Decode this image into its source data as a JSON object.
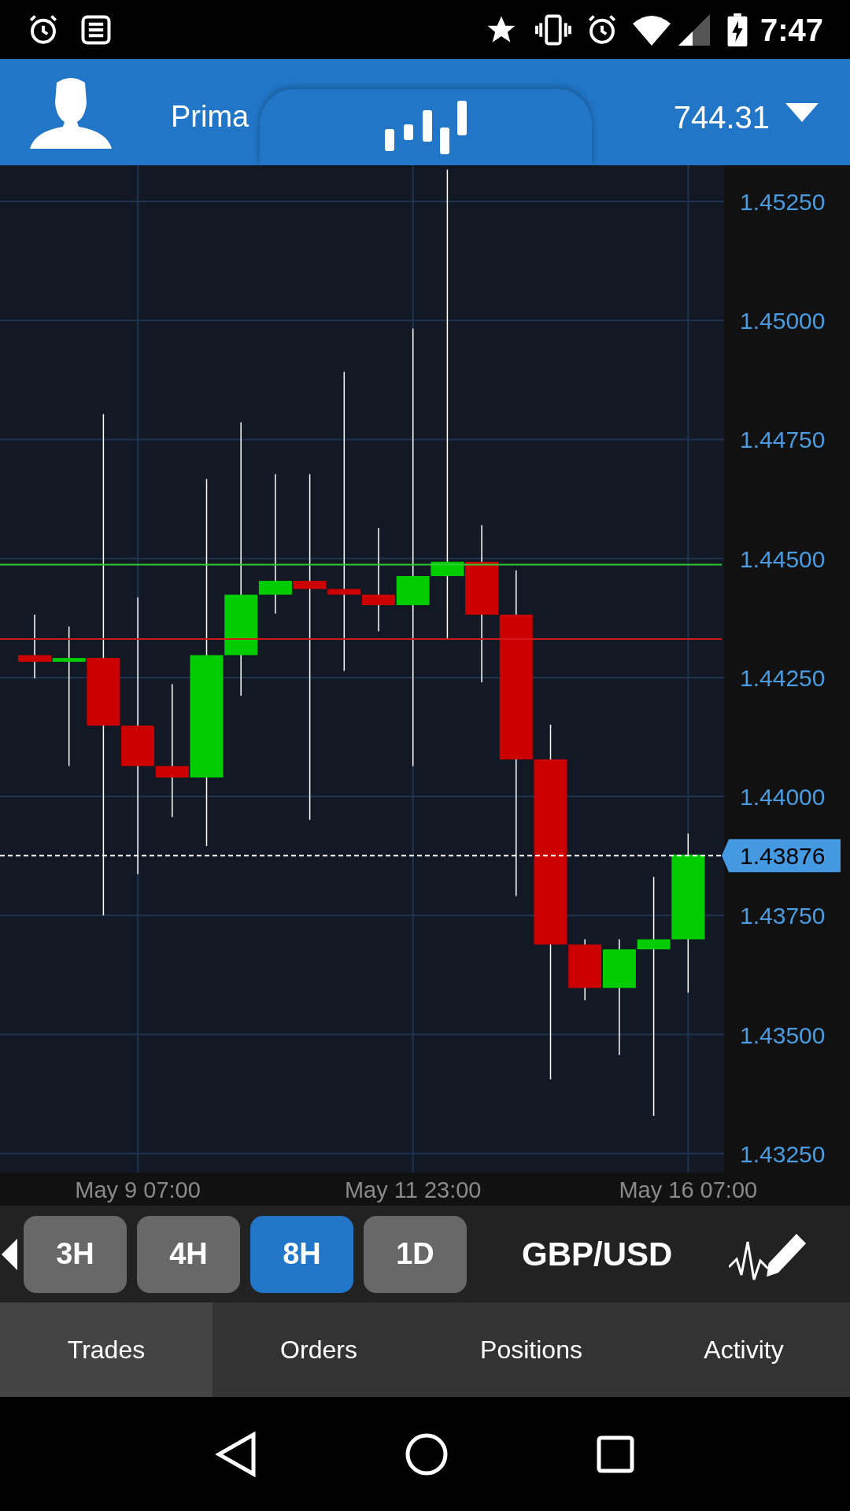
{
  "status_bar": {
    "time": "7:47"
  },
  "header": {
    "account": "Prima",
    "balance": "744.31"
  },
  "chart": {
    "current_price": "1.43876",
    "chart_data": {
      "type": "candlestick",
      "categories": [
        null,
        null,
        null,
        "May 9 07:00",
        null,
        null,
        null,
        null,
        null,
        null,
        null,
        "May 11 23:00",
        null,
        null,
        null,
        null,
        null,
        null,
        null,
        "May 16 07:00"
      ],
      "ohlc": [
        [
          1.44297,
          1.44382,
          1.44248,
          1.44283
        ],
        [
          1.44283,
          1.44357,
          1.44064,
          1.44291
        ],
        [
          1.44291,
          1.44803,
          1.4375,
          1.44149
        ],
        [
          1.44149,
          1.44418,
          1.43837,
          1.44064
        ],
        [
          1.44064,
          1.44236,
          1.43957,
          1.4404
        ],
        [
          1.4404,
          1.44667,
          1.43896,
          1.44297
        ],
        [
          1.44297,
          1.44786,
          1.44212,
          1.44424
        ],
        [
          1.44424,
          1.44677,
          1.44384,
          1.44453
        ],
        [
          1.44453,
          1.44677,
          1.43951,
          1.44436
        ],
        [
          1.44436,
          1.44892,
          1.44264,
          1.44424
        ],
        [
          1.44424,
          1.44564,
          1.44347,
          1.44402
        ],
        [
          1.44402,
          1.44983,
          1.44064,
          1.44463
        ],
        [
          1.44463,
          1.45317,
          1.44331,
          1.44493
        ],
        [
          1.44493,
          1.4457,
          1.4424,
          1.44382
        ],
        [
          1.44382,
          1.44475,
          1.43791,
          1.44078
        ],
        [
          1.44078,
          1.44151,
          1.43406,
          1.43689
        ],
        [
          1.43689,
          1.437,
          1.43572,
          1.43598
        ],
        [
          1.43598,
          1.437,
          1.43457,
          1.43679
        ],
        [
          1.43679,
          1.43831,
          1.43329,
          1.437
        ],
        [
          1.437,
          1.43922,
          1.43588,
          1.43878
        ]
      ],
      "ylim": [
        1.4321,
        1.45326
      ],
      "yticks": [
        {
          "value": 1.4525,
          "label": "1.45250"
        },
        {
          "value": 1.45,
          "label": "1.45000"
        },
        {
          "value": 1.4475,
          "label": "1.44750"
        },
        {
          "value": 1.445,
          "label": "1.44500"
        },
        {
          "value": 1.4425,
          "label": "1.44250"
        },
        {
          "value": 1.44,
          "label": "1.44000"
        },
        {
          "value": 1.4375,
          "label": "1.43750"
        },
        {
          "value": 1.435,
          "label": "1.43500"
        },
        {
          "value": 1.4325,
          "label": "1.43250"
        }
      ],
      "grid": true,
      "ref_lines": [
        {
          "axis": "y",
          "value": 1.44487,
          "color": "#2ecc2e"
        },
        {
          "axis": "y",
          "value": 1.44331,
          "color": "#d01818"
        },
        {
          "axis": "y",
          "value": 1.43876,
          "color": "#ffffff"
        }
      ]
    }
  },
  "timeframes": [
    {
      "label": "3H",
      "selected": false
    },
    {
      "label": "4H",
      "selected": false
    },
    {
      "label": "8H",
      "selected": true
    },
    {
      "label": "1D",
      "selected": false
    }
  ],
  "symbol": "GBP/USD",
  "tabs": [
    {
      "label": "Trades",
      "selected": true
    },
    {
      "label": "Orders",
      "selected": false
    },
    {
      "label": "Positions",
      "selected": false
    },
    {
      "label": "Activity",
      "selected": false
    }
  ]
}
